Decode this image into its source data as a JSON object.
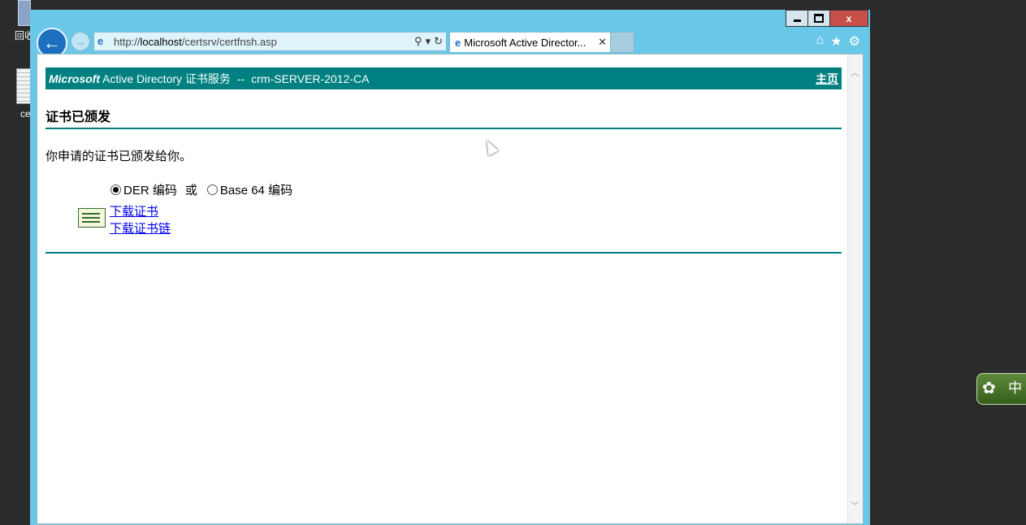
{
  "desktop": {
    "recycle_label": "回收站",
    "file_label": "ce"
  },
  "ime": {
    "label": "中"
  },
  "browser": {
    "url_prefix": "http://",
    "url_host": "localhost",
    "url_path": "/certsrv/certfnsh.asp",
    "tab_title": "Microsoft Active Director...",
    "window_controls": {
      "minimize": "_",
      "maximize": "□",
      "close": "x"
    }
  },
  "page": {
    "banner": {
      "brand": "Microsoft",
      "service": "Active Directory 证书服务",
      "separator": "--",
      "ca_name": "crm-SERVER-2012-CA",
      "home_link": "主页"
    },
    "heading": "证书已颁发",
    "message": "你申请的证书已颁发给你。",
    "encoding": {
      "der_label": "DER 编码",
      "or_label": "或",
      "base64_label": "Base 64 编码",
      "selected": "DER 编码"
    },
    "links": {
      "download_cert": "下载证书",
      "download_chain": "下载证书链"
    }
  }
}
